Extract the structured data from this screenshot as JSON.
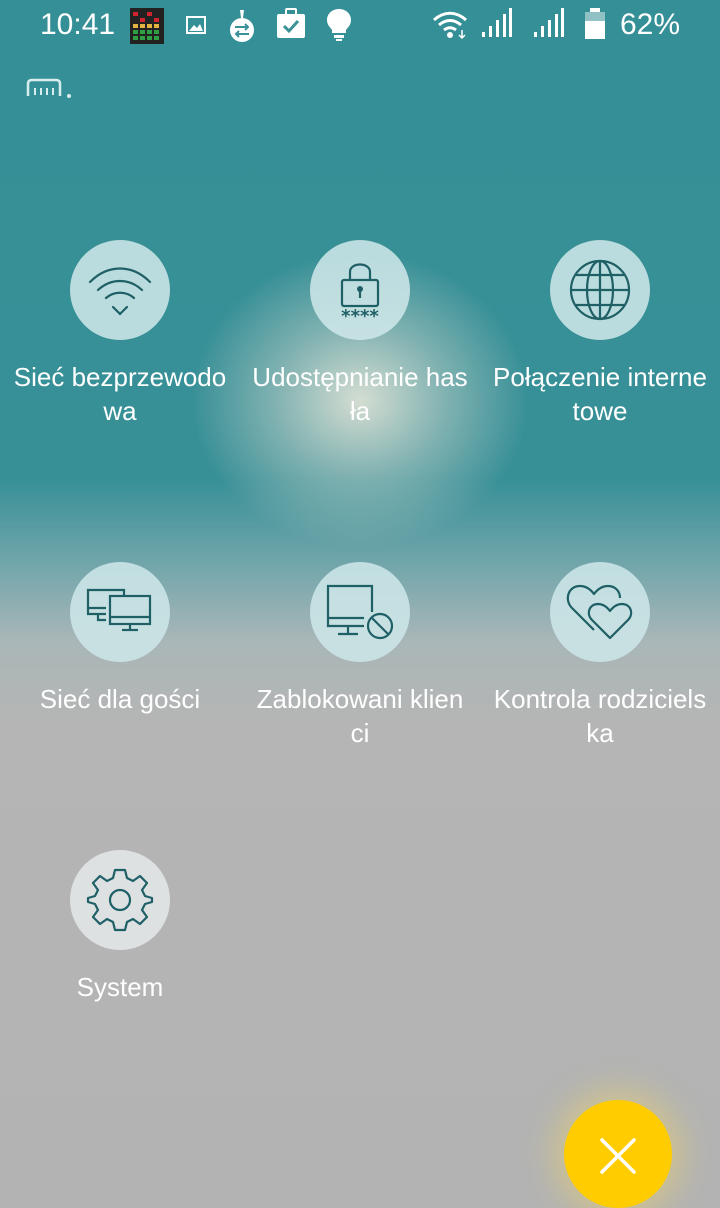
{
  "status_bar": {
    "time": "10:41",
    "battery_percent": "62%"
  },
  "menu": {
    "items": [
      {
        "label": "Sieć bezprzewodowa",
        "icon": "wifi-icon"
      },
      {
        "label": "Udostępnianie hasła",
        "icon": "lock-password-icon"
      },
      {
        "label": "Połączenie internetowe",
        "icon": "globe-icon"
      },
      {
        "label": "Sieć dla gości",
        "icon": "monitors-icon"
      },
      {
        "label": "Zablokowani klienci",
        "icon": "blocked-monitor-icon"
      },
      {
        "label": "Kontrola rodzicielska",
        "icon": "hearts-icon"
      },
      {
        "label": "System",
        "icon": "gear-icon"
      }
    ]
  },
  "close_button": {
    "icon": "close-icon"
  },
  "colors": {
    "accent_teal": "#348f96",
    "icon_stroke": "#1f5f66",
    "fab_yellow": "#ffcc00"
  }
}
